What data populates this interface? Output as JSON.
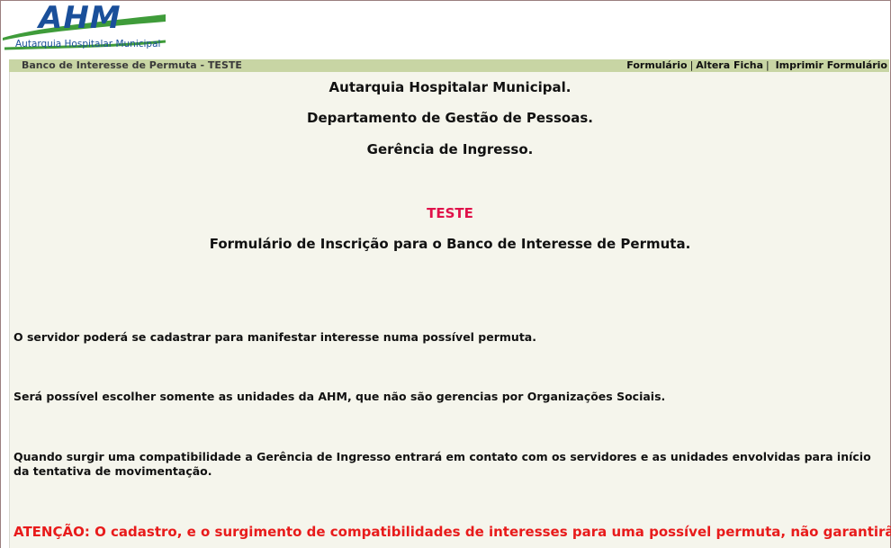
{
  "logo": {
    "main_text": "AHM",
    "sub_text": "Autarquia Hospitalar Municipal"
  },
  "header": {
    "title": "Banco de Interesse de Permuta - TESTE",
    "links": {
      "formulario": "Formulário",
      "sep1": "|",
      "altera_ficha": "Altera Ficha",
      "sep2": "|",
      "imprimir": "Imprimir Formulário"
    }
  },
  "content": {
    "org_line1": "Autarquia Hospitalar Municipal.",
    "org_line2": "Departamento de Gestão de Pessoas.",
    "org_line3": "Gerência de Ingresso.",
    "badge": "TESTE",
    "form_title": "Formulário de Inscrição para o Banco de Interesse de Permuta.",
    "paragraph1": "O servidor poderá se cadastrar para manifestar interesse numa possível permuta.",
    "paragraph2": "Será possível escolher somente as unidades da AHM, que não são gerencias por Organizações Sociais.",
    "paragraph3": "Quando surgir uma compatibilidade a Gerência de Ingresso entrará em contato com os servidores e as unidades envolvidas para início da tentativa de movimentação.",
    "attention": "ATENÇÃO: O cadastro, e o surgimento de compatibilidades de interesses para uma possível permuta, não garantirão que o"
  },
  "colors": {
    "header_bar": "#c8d5a4",
    "content_bg": "#f5f5ec",
    "teste": "#e0114a",
    "attention": "#e81b1b",
    "logo_blue": "#1a4f9a",
    "logo_green": "#3f9c3a"
  }
}
